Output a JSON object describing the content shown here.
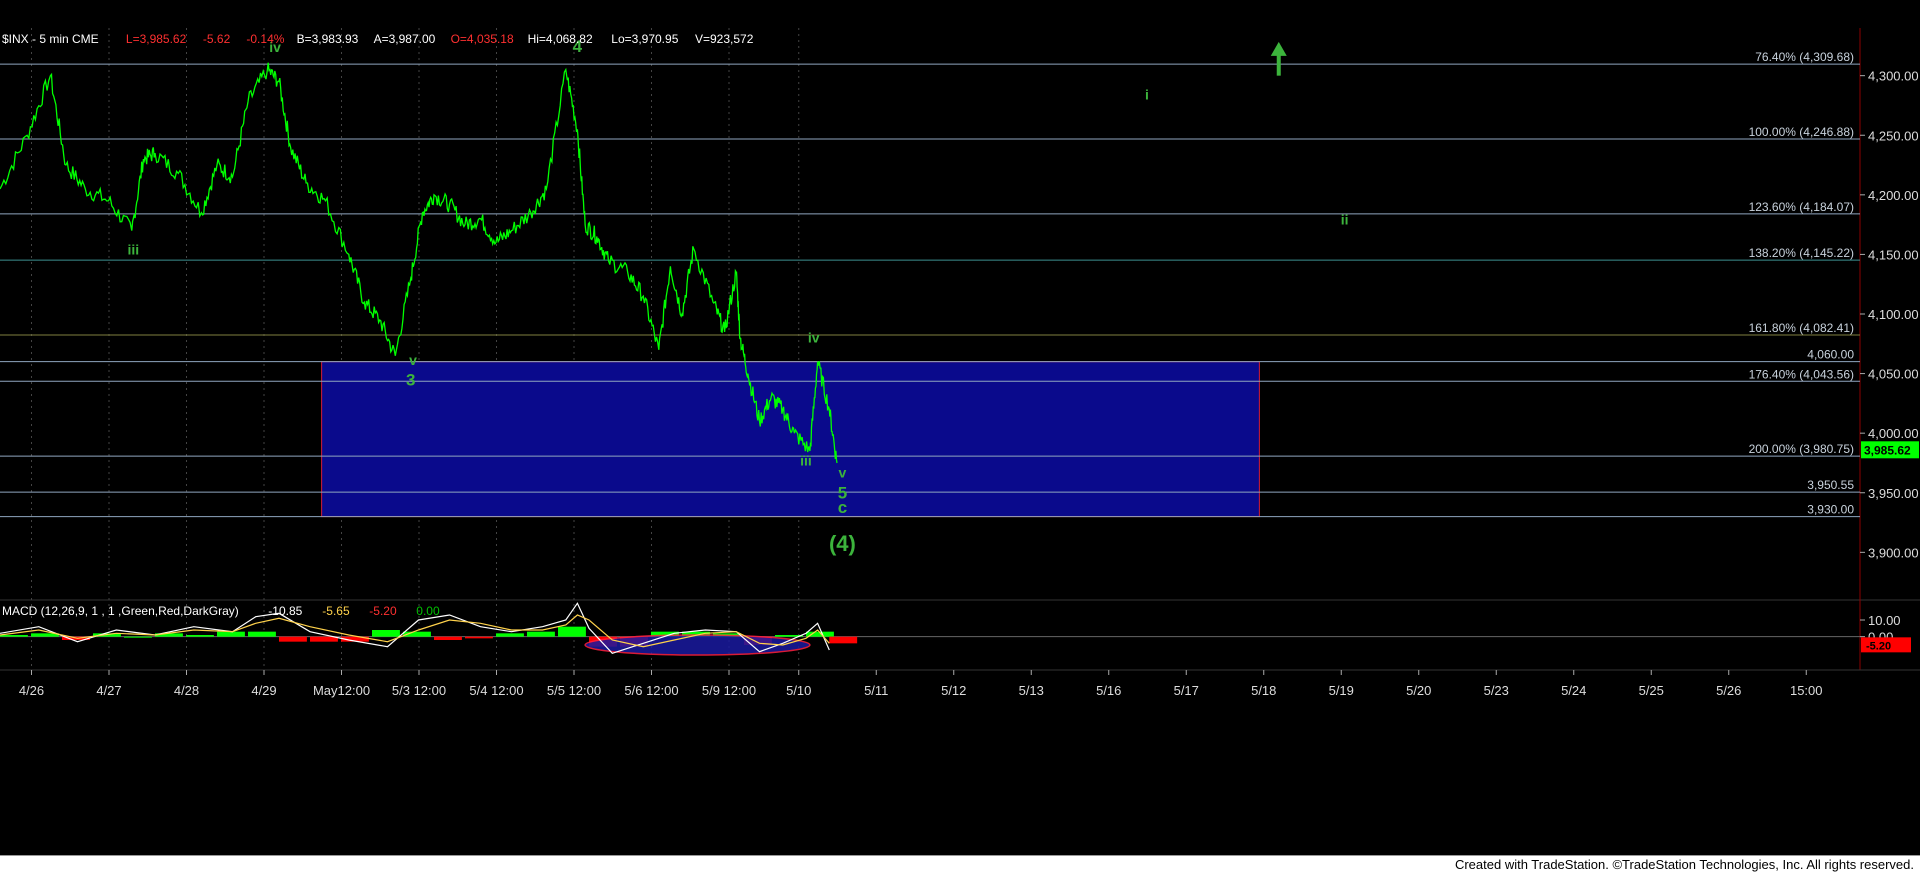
{
  "header": {
    "symbol": "$INX - 5 min  CME",
    "last": "L=3,985.62",
    "change": "-5.62",
    "pct": "-0.14%",
    "bid": "B=3,983.93",
    "ask": "A=3,987.00",
    "open": "O=4,035.18",
    "high": "Hi=4,068.82",
    "low": "Lo=3,970.95",
    "volume": "V=923,572"
  },
  "footer": {
    "credit": "Created with TradeStation. ©TradeStation Technologies, Inc. All rights reserved."
  },
  "colors": {
    "background": "#000000",
    "price": "#00ff00",
    "wave_label": "#3cb43c",
    "fib_line": "#8fa6bf",
    "box_fill": "#0a0a8c",
    "box_border": "#d21e3c",
    "last_price_tag": "#00ff00",
    "macd_line": "#ffffff",
    "signal_line": "#ffd24b",
    "hist_pos": "#00ff00",
    "hist_neg": "#ff0000"
  },
  "chart_data": [
    {
      "type": "line",
      "title": "$INX - 5 min  CME",
      "ylim": [
        3860,
        4340
      ],
      "y_ticks": [
        "4,300.00",
        "4,250.00",
        "4,200.00",
        "4,150.00",
        "4,100.00",
        "4,050.00",
        "4,000.00",
        "3,950.00",
        "3,900.00"
      ],
      "y_tick_values": [
        4300,
        4250,
        4200,
        4150,
        4100,
        4050,
        4000,
        3950,
        3900
      ],
      "x_ticks": [
        "4/26",
        "4/27",
        "4/28",
        "4/29",
        "May12:00",
        "5/3 12:00",
        "5/4 12:00",
        "5/5 12:00",
        "5/6 12:00",
        "5/9 12:00",
        "5/10",
        "5/11",
        "5/12",
        "5/13",
        "5/16",
        "5/17",
        "5/18",
        "5/19",
        "5/20",
        "5/23",
        "5/24",
        "5/25",
        "5/26",
        "15:00"
      ],
      "x_tick_index": [
        0.6,
        1.6,
        2.6,
        3.6,
        4.6,
        5.6,
        6.6,
        7.6,
        8.6,
        9.6,
        10.5,
        11.5,
        12.5,
        13.5,
        14.5,
        15.5,
        16.5,
        17.5,
        18.5,
        19.5,
        20.5,
        21.5,
        22.5,
        23.5
      ],
      "x_range": [
        0,
        24
      ],
      "series": [
        {
          "x": [
            0.0,
            0.35,
            0.65,
            0.85,
            1.1,
            1.4,
            1.7,
            1.85,
            2.0,
            2.3,
            2.6,
            2.8,
            3.0,
            3.2,
            3.45,
            3.6,
            3.75,
            3.95,
            4.2,
            4.5,
            4.7,
            4.9,
            5.1,
            5.3,
            5.45,
            5.6,
            5.8,
            6.0,
            6.2,
            6.4,
            6.6,
            6.85,
            7.05,
            7.3,
            7.45,
            7.55,
            7.7,
            7.85,
            8.1,
            8.3,
            8.5,
            8.65,
            8.8,
            8.95,
            9.2,
            9.35,
            9.5,
            9.55,
            9.65,
            9.8,
            9.95,
            10.1,
            10.25,
            10.45,
            10.55,
            10.7,
            10.8
          ],
          "y": [
            4205,
            4250,
            4300,
            4225,
            4205,
            4195,
            4170,
            4230,
            4235,
            4218,
            4185,
            4225,
            4215,
            4278,
            4305,
            4295,
            4240,
            4210,
            4195,
            4150,
            4110,
            4095,
            4065,
            4130,
            4185,
            4200,
            4192,
            4175,
            4180,
            4160,
            4170,
            4185,
            4205,
            4305,
            4255,
            4175,
            4165,
            4145,
            4135,
            4115,
            4070,
            4140,
            4100,
            4155,
            4110,
            4085,
            4135,
            4080,
            4050,
            4010,
            4030,
            4020,
            4000,
            3985,
            4060,
            4020,
            3975
          ]
        }
      ],
      "fib_levels": [
        {
          "label": "76.40% (4,309.68)",
          "value": 4309.68,
          "color": "#8fa6bf"
        },
        {
          "label": "100.00% (4,246.88)",
          "value": 4246.88,
          "color": "#8fa6bf"
        },
        {
          "label": "123.60% (4,184.07)",
          "value": 4184.07,
          "color": "#8fa6bf"
        },
        {
          "label": "138.20% (4,145.22)",
          "value": 4145.22,
          "color": "#3d8f8f"
        },
        {
          "label": "161.80% (4,082.41)",
          "value": 4082.41,
          "color": "#7f7f3f"
        },
        {
          "label": "4,060.00",
          "value": 4060.0,
          "color": "#8fa6bf"
        },
        {
          "label": "176.40% (4,043.56)",
          "value": 4043.56,
          "color": "#8fa6bf"
        },
        {
          "label": "200.00% (3,980.75)",
          "value": 3980.75,
          "color": "#8fa6bf"
        },
        {
          "label": "3,950.55",
          "value": 3950.55,
          "color": "#8fa6bf"
        },
        {
          "label": "3,930.00",
          "value": 3930.0,
          "color": "#8fa6bf"
        }
      ],
      "target_box": {
        "x0": 4.15,
        "x1": 16.25,
        "y_top": 4060.0,
        "y_bottom": 3930.0
      },
      "last_price_label": "3,985.62",
      "last_price_value": 3985.62,
      "wave_labels": [
        {
          "text": "iv",
          "x": 3.55,
          "y": 4320
        },
        {
          "text": "iii",
          "x": 1.72,
          "y": 4150
        },
        {
          "text": "4",
          "x": 7.45,
          "y": 4320
        },
        {
          "text": "v",
          "x": 5.33,
          "y": 4057
        },
        {
          "text": "3",
          "x": 5.3,
          "y": 4040
        },
        {
          "text": "iv",
          "x": 10.5,
          "y": 4076
        },
        {
          "text": "iii",
          "x": 10.4,
          "y": 3973
        },
        {
          "text": "v",
          "x": 10.87,
          "y": 3963
        },
        {
          "text": "5",
          "x": 10.87,
          "y": 3945
        },
        {
          "text": "c",
          "x": 10.87,
          "y": 3933
        },
        {
          "text": "(4)",
          "x": 10.87,
          "y": 3901
        },
        {
          "text": "i",
          "x": 14.8,
          "y": 4280
        },
        {
          "text": "ii",
          "x": 17.35,
          "y": 4175
        }
      ],
      "up_arrow": {
        "x": 16.5,
        "y_from": 4300,
        "y_to": 4325
      }
    },
    {
      "type": "line",
      "title": "MACD (12,26,9, 1 , 1 ,Green,Red,DarkGray)",
      "header_values": [
        "-10.85",
        "-5.65",
        "-5.20",
        "0.00"
      ],
      "header_colors": [
        "#ffffff",
        "#ffd24b",
        "#ff3030",
        "#00c000"
      ],
      "ylim": [
        -20,
        22
      ],
      "y_ticks": [
        "10.00",
        "0.00"
      ],
      "y_tick_values": [
        10,
        0
      ],
      "last_value_tag": "-5.20",
      "x_range": [
        0,
        24
      ],
      "series": [
        {
          "name": "MACD",
          "x": [
            0.0,
            0.5,
            1.0,
            1.5,
            2.0,
            2.5,
            3.0,
            3.3,
            3.6,
            4.0,
            4.5,
            5.0,
            5.4,
            5.8,
            6.2,
            6.6,
            7.0,
            7.3,
            7.45,
            7.6,
            7.9,
            8.3,
            8.7,
            9.1,
            9.5,
            9.8,
            10.1,
            10.4,
            10.55,
            10.7
          ],
          "y": [
            2,
            6,
            -3,
            4,
            1,
            6,
            3,
            12,
            14,
            3,
            -2,
            -6,
            10,
            13,
            6,
            3,
            6,
            10,
            20,
            5,
            -10,
            -4,
            2,
            4,
            3,
            -9,
            -4,
            2,
            8,
            -8
          ]
        },
        {
          "name": "Signal",
          "x": [
            0.0,
            0.5,
            1.0,
            1.5,
            2.0,
            2.5,
            3.0,
            3.3,
            3.6,
            4.0,
            4.5,
            5.0,
            5.4,
            5.8,
            6.2,
            6.6,
            7.0,
            7.3,
            7.45,
            7.6,
            7.9,
            8.3,
            8.7,
            9.1,
            9.5,
            9.8,
            10.1,
            10.4,
            10.55,
            10.7
          ],
          "y": [
            1,
            4,
            -1,
            2,
            1,
            4,
            3,
            8,
            11,
            6,
            1,
            -3,
            4,
            10,
            8,
            4,
            4,
            7,
            13,
            10,
            -2,
            -6,
            -2,
            2,
            3,
            -4,
            -5,
            -1,
            4,
            -4
          ]
        }
      ],
      "histogram": {
        "x": [
          0.0,
          0.4,
          0.8,
          1.2,
          1.6,
          2.0,
          2.4,
          2.8,
          3.2,
          3.6,
          4.0,
          4.4,
          4.8,
          5.2,
          5.6,
          6.0,
          6.4,
          6.8,
          7.2,
          7.6,
          8.0,
          8.4,
          8.8,
          9.2,
          9.6,
          10.0,
          10.4,
          10.7
        ],
        "y": [
          1,
          2,
          -2,
          2,
          0,
          2,
          1,
          3,
          3,
          -3,
          -3,
          -3,
          4,
          3,
          -2,
          -1,
          2,
          3,
          6,
          -6,
          -6,
          3,
          3,
          2,
          -5,
          1,
          3,
          -4
        ]
      },
      "ellipse": {
        "cx": 9.0,
        "cy": -5,
        "rx": 1.45,
        "ry": 6
      }
    }
  ]
}
